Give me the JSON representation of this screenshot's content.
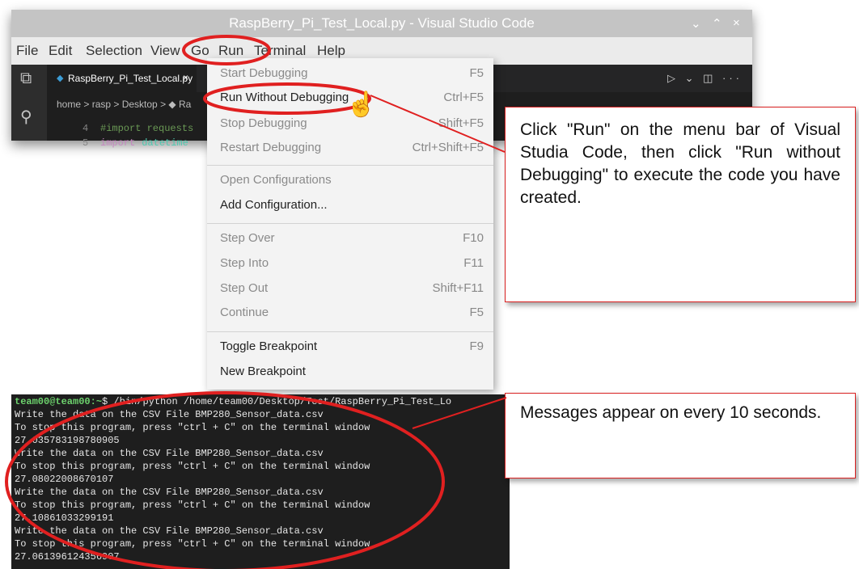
{
  "window": {
    "title": "RaspBerry_Pi_Test_Local.py - Visual Studio Code",
    "controls": [
      "⌄",
      "⌃",
      "×"
    ]
  },
  "menubar": [
    "File",
    "Edit",
    "Selection",
    "View",
    "Go",
    "Run",
    "Terminal",
    "Help"
  ],
  "editor": {
    "tab_name": "RaspBerry_Pi_Test_Local.py",
    "tab_close": "×",
    "breadcrumb": "home > rasp > Desktop > ◆ Ra",
    "lines": [
      {
        "num": "4",
        "text": "#import requests"
      },
      {
        "num": "5",
        "kw": "import",
        "mod": "datetime"
      }
    ],
    "actions": "▷ ⌄ ◫ ···"
  },
  "run_menu": {
    "items": [
      {
        "label": "Start Debugging",
        "shortcut": "F5",
        "state": "disabled"
      },
      {
        "label": "Run Without Debugging",
        "shortcut": "Ctrl+F5",
        "state": "enabled"
      },
      {
        "label": "Stop Debugging",
        "shortcut": "Shift+F5",
        "state": "disabled"
      },
      {
        "label": "Restart Debugging",
        "shortcut": "Ctrl+Shift+F5",
        "state": "disabled"
      },
      {
        "label": "Open Configurations",
        "shortcut": "",
        "state": "disabled"
      },
      {
        "label": "Add Configuration...",
        "shortcut": "",
        "state": "enabled"
      },
      {
        "label": "Step Over",
        "shortcut": "F10",
        "state": "disabled"
      },
      {
        "label": "Step Into",
        "shortcut": "F11",
        "state": "disabled"
      },
      {
        "label": "Step Out",
        "shortcut": "Shift+F11",
        "state": "disabled"
      },
      {
        "label": "Continue",
        "shortcut": "F5",
        "state": "disabled"
      },
      {
        "label": "Toggle Breakpoint",
        "shortcut": "F9",
        "state": "enabled"
      },
      {
        "label": "New Breakpoint",
        "shortcut": "",
        "state": "enabled"
      }
    ]
  },
  "terminal": {
    "prompt": "team00@team00:~",
    "command": "$ /bin/python /home/team00/Desktop/Test/RaspBerry_Pi_Test_Lo",
    "output": [
      "Write the data on the CSV File BMP280_Sensor_data.csv",
      "To stop this program, press \"ctrl + C\" on the terminal window",
      "27.035783198780905",
      "Write the data on the CSV File BMP280_Sensor_data.csv",
      "To stop this program, press \"ctrl + C\" on the terminal window",
      "27.08022008670107",
      "Write the data on the CSV File BMP280_Sensor_data.csv",
      "To stop this program, press \"ctrl + C\" on the terminal window",
      "27.10861033299191",
      "Write the data on the CSV File BMP280_Sensor_data.csv",
      "To stop this program, press \"ctrl + C\" on the terminal window",
      "27.061396124356907"
    ]
  },
  "callouts": {
    "run_instruction": "Click \"Run\" on the menu bar of Visual Studia Code, then click \"Run without Debugging\" to execute the code you have created.",
    "messages_note": "Messages appear on every 10 seconds."
  },
  "colors": {
    "highlight": "#e02020",
    "callout_border": "#d92020",
    "terminal_bg": "#1e1e1e"
  }
}
